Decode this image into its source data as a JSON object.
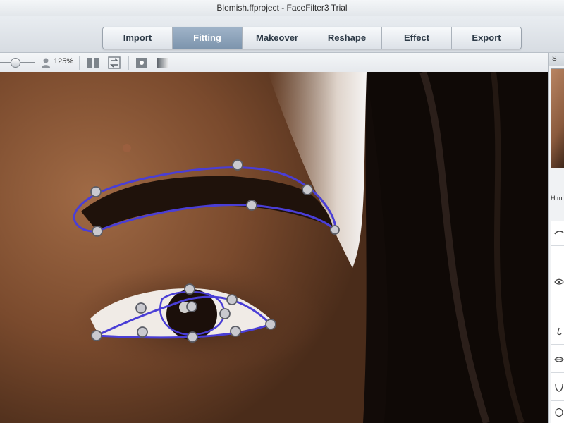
{
  "window": {
    "title": "Blemish.ffproject - FaceFilter3 Trial"
  },
  "nav": {
    "tabs": [
      {
        "label": "Import",
        "active": false
      },
      {
        "label": "Fitting",
        "active": true
      },
      {
        "label": "Makeover",
        "active": false
      },
      {
        "label": "Reshape",
        "active": false
      },
      {
        "label": "Effect",
        "active": false
      },
      {
        "label": "Export",
        "active": false
      }
    ]
  },
  "toolbar": {
    "zoom_label": "125%",
    "zoom_value": 1.25,
    "icons": [
      "person-icon",
      "split-view-icon",
      "swap-view-icon",
      "point-icon",
      "gradient-icon"
    ]
  },
  "side_panel": {
    "header_label": "S",
    "tip_text": "H m",
    "items": [
      "eyebrow-feature-icon",
      "eye-feature-icon",
      "nose-feature-icon",
      "lips-feature-icon",
      "jaw-feature-icon",
      "face-outline-icon"
    ]
  },
  "colors": {
    "accent": "#7d95ad",
    "curve": "#4a3ed6",
    "handle_fill": "#c9c9cf",
    "handle_stroke": "#5b5d66"
  }
}
